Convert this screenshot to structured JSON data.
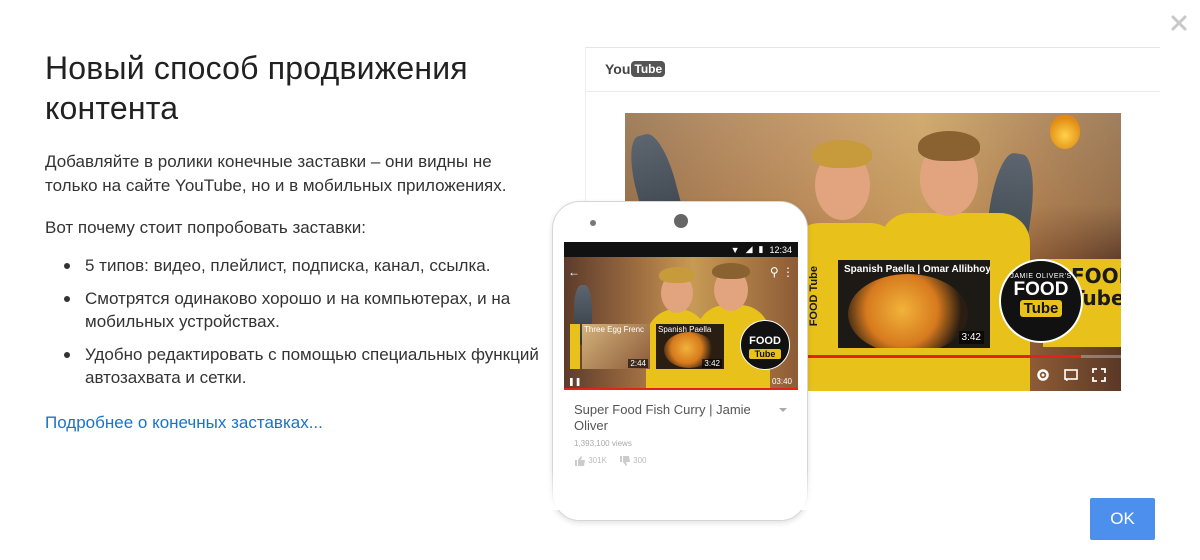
{
  "dialog": {
    "title": "Новый способ продвижения контента",
    "description": "Добавляйте в ролики конечные заставки – они видны не только на сайте YouTube, но и в мобильных приложениях.",
    "why_heading": "Вот почему стоит попробовать заставки:",
    "bullets": [
      "5 типов: видео, плейлист, подписка, канал, ссылка.",
      "Смотрятся одинаково хорошо и на компьютерах, и на мобильных устройствах.",
      "Удобно редактировать с помощью специальных функций автозахвата и сетки."
    ],
    "more_link": "Подробнее о конечных заставках...",
    "ok_label": "OK",
    "close_icon": "close-icon"
  },
  "illustration": {
    "desktop": {
      "logo_you": "You",
      "logo_tube": "Tube",
      "endcard_title": "Spanish Paella | Omar Allibhoy",
      "endcard_time": "3:42",
      "banner_text": "FOOD Tube",
      "circle_small": "JAMIE OLIVER'S",
      "circle_big": "FOOD",
      "circle_tube": "Tube",
      "right_banner": "FOOD Tube",
      "progress": 0.92
    },
    "phone": {
      "status_time": "12:34",
      "card1_label": "Three Egg Frenc",
      "card1_time": "2:44",
      "card2_label": "Spanish Paella",
      "card2_time": "3:42",
      "elapsed": "03:40",
      "video_title": "Super Food Fish Curry | Jamie Oliver",
      "views": "1,393,100 views",
      "likes": "301K",
      "dislikes": "300"
    },
    "colors": {
      "accent_blue": "#4d8fec",
      "link_blue": "#1a73c8",
      "progress_red": "#e62117",
      "shirt_yellow": "#e8c21a"
    }
  }
}
